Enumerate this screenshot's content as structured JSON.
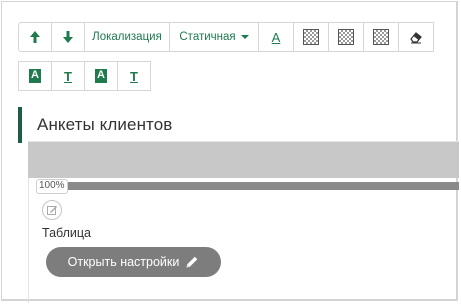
{
  "toolbar": {
    "localization_label": "Локализация",
    "static_label": "Статичная",
    "font_color_letter": "A",
    "row2_letters": [
      "A",
      "T",
      "A",
      "T"
    ]
  },
  "section": {
    "title": "Анкеты клиентов"
  },
  "progress": {
    "percent_label": "100%",
    "value": 1.0
  },
  "widget": {
    "label": "Таблица",
    "open_settings_label": "Открыть настройки"
  },
  "colors": {
    "accent": "#1f7a4d",
    "rail": "#1f5c44",
    "band": "#c8c8c8",
    "progress": "#8a8a8a",
    "button": "#7d7d7d"
  },
  "icons": {
    "move_up": "arrow-up-icon",
    "move_down": "arrow-down-icon",
    "eraser": "eraser-icon",
    "edit": "pencil-icon"
  }
}
